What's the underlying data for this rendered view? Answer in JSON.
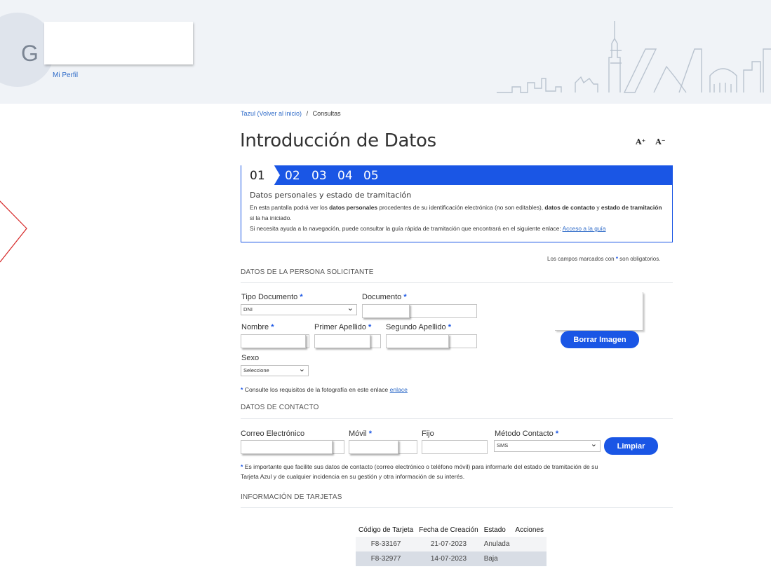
{
  "header": {
    "logo_letter": "G",
    "profile_link": "Mi Perfil"
  },
  "breadcrumb": {
    "home": "Tazul (Volver al inicio)",
    "separator": "/",
    "current": "Consultas"
  },
  "page_title": "Introducción de Datos",
  "font_controls": {
    "increase": "A⁺",
    "decrease": "A⁻"
  },
  "steps": {
    "items": [
      "01",
      "02",
      "03",
      "04",
      "05"
    ],
    "active": "01",
    "title": "Datos personales y estado de tramitación",
    "desc_1a": "En esta pantalla podrá ver los ",
    "desc_1b": "datos personales",
    "desc_1c": " procedentes de su identificación electrónica (no son editables), ",
    "desc_1d": "datos de contacto",
    "desc_1e": " y ",
    "desc_1f": "estado de tramitación",
    "desc_1g": " si la ha iniciado.",
    "desc_2": "Si necesita ayuda a la navegación, puede consultar la guía rápida de tramitación que encontrará en el siguiente enlace: ",
    "desc_2_link": "Acceso a la guía"
  },
  "required_note_a": "Los campos marcados con ",
  "required_star": "*",
  "required_note_b": " son obligatorios.",
  "solicitante": {
    "section_title": "DATOS DE LA PERSONA SOLICITANTE",
    "tipo_documento_label": "Tipo Documento",
    "tipo_documento_value": "DNI",
    "documento_label": "Documento",
    "nombre_label": "Nombre",
    "primer_apellido_label": "Primer Apellido",
    "segundo_apellido_label": "Segundo Apellido",
    "sexo_label": "Sexo",
    "sexo_value": "Seleccione",
    "borrar_imagen": "Borrar Imagen",
    "foto_note": "Consulte los requisitos de la fotografía en este enlace ",
    "foto_link": "enlace"
  },
  "contacto": {
    "section_title": "DATOS DE CONTACTO",
    "correo_label": "Correo Electrónico",
    "movil_label": "Móvil",
    "fijo_label": "Fijo",
    "metodo_label": "Método Contacto",
    "metodo_value": "SMS",
    "limpiar": "Limpiar",
    "note_1": "Es importante que facilite sus datos de contacto (correo electrónico o teléfono móvil) para informarle del estado de tramitación de su",
    "note_2": "Tarjeta Azul y de cualquier incidencia en su gestión y otra información de su interés."
  },
  "tarjetas": {
    "section_title": "INFORMACIÓN DE TARJETAS",
    "columns": [
      "Código de Tarjeta",
      "Fecha de Creación",
      "Estado",
      "Acciones"
    ],
    "rows": [
      {
        "codigo": "F8-33167",
        "fecha": "21-07-2023",
        "estado": "Anulada",
        "acciones": ""
      },
      {
        "codigo": "F8-32977",
        "fecha": "14-07-2023",
        "estado": "Baja",
        "acciones": ""
      }
    ]
  },
  "colors": {
    "primary": "#1a56e5",
    "link": "#2d6ac8",
    "header_bg": "#f0f3f7",
    "deco_red": "#d62828"
  },
  "icons": [
    "chevron-down-icon",
    "skyline-illustration",
    "chevron-right-decoration"
  ]
}
